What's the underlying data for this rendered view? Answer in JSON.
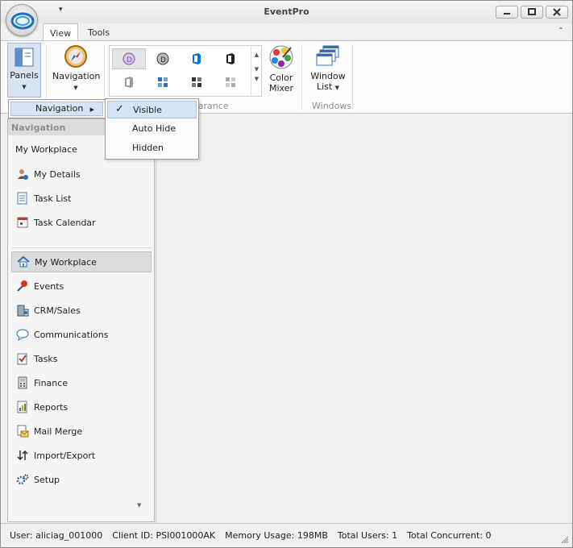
{
  "window": {
    "title": "EventPro",
    "qat_glyph": "▾",
    "collapse_glyph": "⌃"
  },
  "tabs": [
    {
      "label": "View",
      "active": true
    },
    {
      "label": "Tools",
      "active": false
    }
  ],
  "ribbon": {
    "panels_label": "Panels",
    "navigation_label": "Navigation",
    "color_mixer_label_1": "Color",
    "color_mixer_label_2": "Mixer",
    "window_list_label_1": "Window",
    "window_list_label_2": "List",
    "appearance_group_label": "earance",
    "windows_group_label": "Windows",
    "dropdown_glyph": "▼"
  },
  "panels_menu": {
    "item_label": "Navigation",
    "submenu_glyph": "▶"
  },
  "navigation_submenu": {
    "items": [
      {
        "label": "Visible",
        "checked": true
      },
      {
        "label": "Auto Hide",
        "checked": false
      },
      {
        "label": "Hidden",
        "checked": false
      }
    ],
    "check_glyph": "✓"
  },
  "nav": {
    "header": "Navigation",
    "section_title": "My Workplace",
    "workplace_items": [
      {
        "label": "My Details",
        "icon": "person-info-icon"
      },
      {
        "label": "Task List",
        "icon": "task-list-icon"
      },
      {
        "label": "Task Calendar",
        "icon": "calendar-icon"
      }
    ],
    "modules": [
      {
        "label": "My Workplace",
        "icon": "house-icon",
        "selected": true
      },
      {
        "label": "Events",
        "icon": "pushpin-icon"
      },
      {
        "label": "CRM/Sales",
        "icon": "building-icon"
      },
      {
        "label": "Communications",
        "icon": "speech-bubble-icon"
      },
      {
        "label": "Tasks",
        "icon": "task-check-icon"
      },
      {
        "label": "Finance",
        "icon": "calculator-icon"
      },
      {
        "label": "Reports",
        "icon": "report-icon"
      },
      {
        "label": "Mail Merge",
        "icon": "mail-merge-icon"
      },
      {
        "label": "Import/Export",
        "icon": "import-export-icon"
      },
      {
        "label": "Setup",
        "icon": "gears-icon"
      }
    ],
    "more_glyph": "▼"
  },
  "status_bar": {
    "user": "User: aliciag_001000",
    "client_id": "Client ID: PSI001000AK",
    "memory": "Memory Usage: 198MB",
    "total_users": "Total Users: 1",
    "total_concurrent": "Total Concurrent: 0"
  },
  "colors": {
    "accent": "#2e7fd6",
    "menu_highlight": "#d6e4f3",
    "nav_header_bg": "#dcdcdc",
    "office_orange": "#d83b01",
    "office_blue": "#0078d4"
  }
}
